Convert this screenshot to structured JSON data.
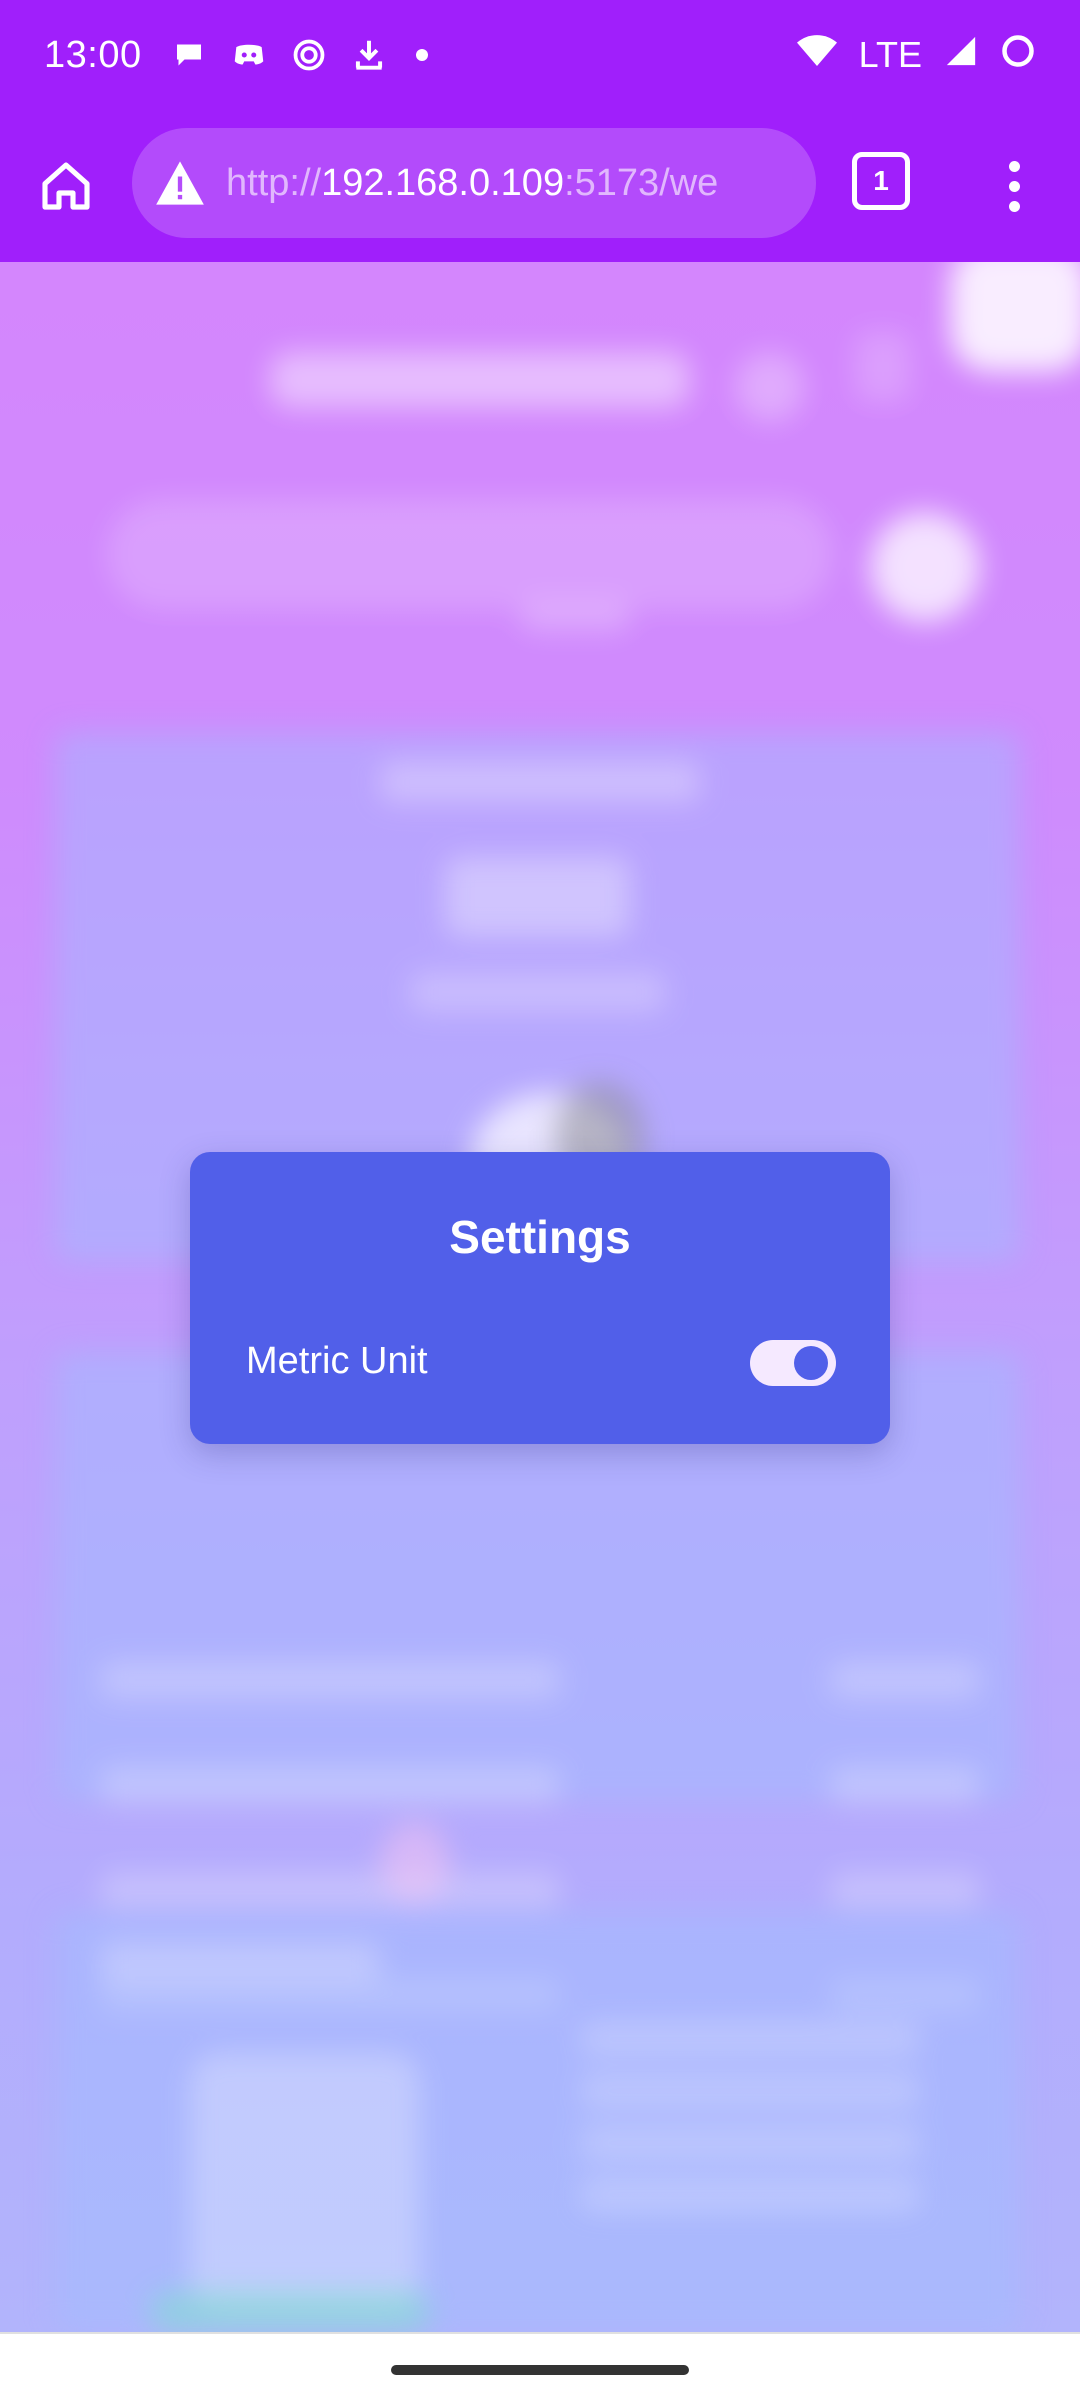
{
  "status_bar": {
    "time": "13:00",
    "network": "LTE",
    "left_icons": [
      "chat-bubble-icon",
      "discord-icon",
      "spiral-icon",
      "download-icon"
    ],
    "right_icons": [
      "wifi-icon",
      "signal-icon",
      "circle-icon"
    ]
  },
  "browser": {
    "url_prefix": "http://",
    "url_host": "192.168.0.109",
    "url_suffix": ":5173/we",
    "tab_count": "1",
    "icons": {
      "home": "home-icon",
      "warning": "warning-triangle-icon",
      "menu": "more-vert-icon"
    }
  },
  "modal": {
    "title": "Settings",
    "metric_label": "Metric Unit",
    "metric_enabled": true
  },
  "colors": {
    "status_bar": "#a01ffb",
    "modal_bg": "#515fe9",
    "toggle_track": "#f5e9ff"
  }
}
